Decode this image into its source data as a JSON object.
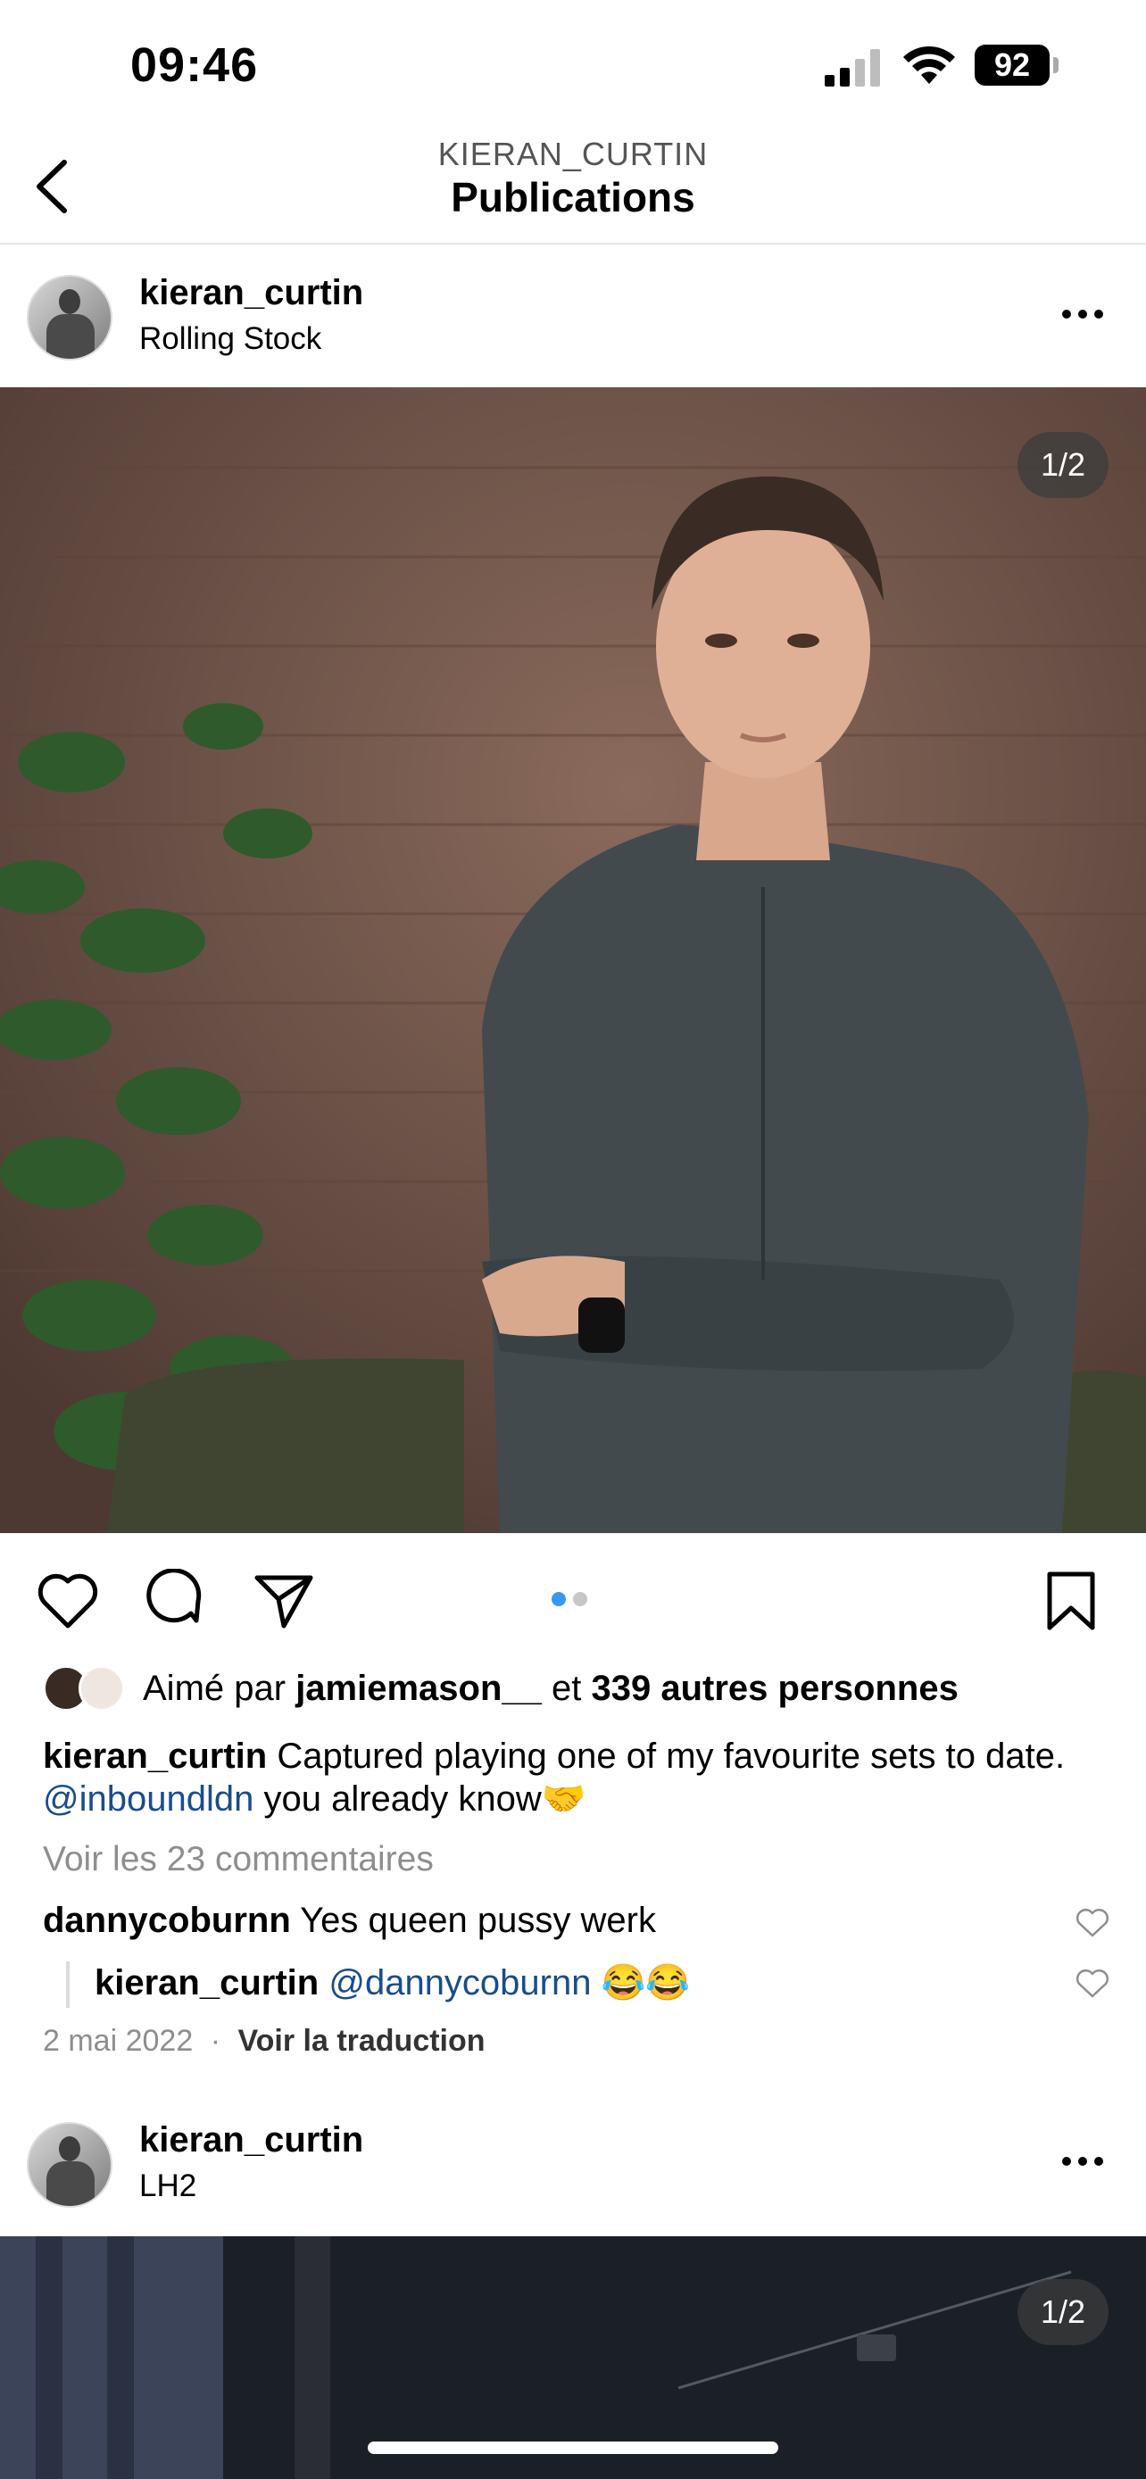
{
  "status_bar": {
    "time": "09:46",
    "battery": "92"
  },
  "nav": {
    "subtitle": "KIERAN_CURTIN",
    "title": "Publications"
  },
  "posts": [
    {
      "username": "kieran_curtin",
      "location": "Rolling Stock",
      "counter": "1/2",
      "likes": {
        "prefix": "Aimé par",
        "user": "jamiemason__",
        "mid": "et",
        "count_text": "339 autres personnes"
      },
      "caption": {
        "user": "kieran_curtin",
        "text": "Captured playing one of my favourite sets to date.",
        "mention": "@inboundldn",
        "suffix": "you already know🤝"
      },
      "view_comments": "Voir les 23 commentaires",
      "comments": [
        {
          "user": "dannycoburnn",
          "text": "Yes queen pussy werk"
        },
        {
          "user": "kieran_curtin",
          "mention": "@dannycoburnn",
          "text": "😂😂"
        }
      ],
      "date": "2 mai 2022",
      "separator": "·",
      "translate": "Voir la traduction"
    },
    {
      "username": "kieran_curtin",
      "location": "LH2",
      "counter": "1/2"
    }
  ],
  "colors": {
    "carousel_active": "#3897f0",
    "carousel_inactive": "#c7c7c7",
    "mention": "#1a4c8c"
  }
}
